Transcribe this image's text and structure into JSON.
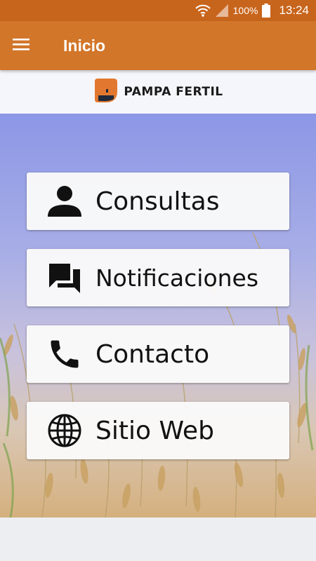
{
  "status_bar": {
    "battery_percent": "100%",
    "time": "13:24",
    "icons": [
      "wifi-icon",
      "signal-icon",
      "battery-icon"
    ]
  },
  "app_bar": {
    "title": "Inicio",
    "menu_icon": "hamburger-menu-icon"
  },
  "brand": {
    "name": "PAMPA FERTIL",
    "logo_icon": "pampa-fertil-logo"
  },
  "menu": {
    "items": [
      {
        "label": "Consultas",
        "icon": "person-icon"
      },
      {
        "label": "Notificaciones",
        "icon": "chat-bubbles-icon"
      },
      {
        "label": "Contacto",
        "icon": "phone-icon"
      },
      {
        "label": "Sitio Web",
        "icon": "globe-icon"
      }
    ]
  },
  "colors": {
    "status_bar": "#c8651c",
    "app_bar": "#d2762a",
    "brand_orange": "#e2782f"
  }
}
